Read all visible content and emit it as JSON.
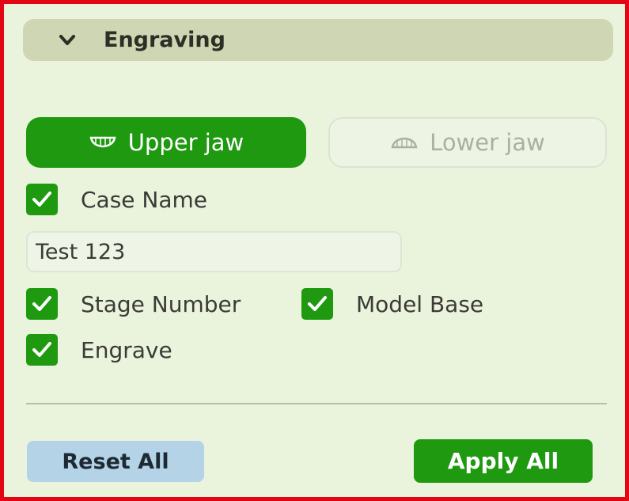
{
  "panel": {
    "title": "Engraving",
    "expanded": true
  },
  "jaw_selector": {
    "upper_label": "Upper jaw",
    "lower_label": "Lower jaw",
    "selected": "upper"
  },
  "case_name": {
    "label": "Case Name",
    "checked": true,
    "value": "Test 123"
  },
  "stage_number": {
    "label": "Stage Number",
    "checked": true
  },
  "model_base": {
    "label": "Model Base",
    "checked": true
  },
  "engrave": {
    "label": "Engrave",
    "checked": true
  },
  "footer": {
    "reset_label": "Reset All",
    "apply_label": "Apply All"
  },
  "colors": {
    "accent_green": "#1f9a10",
    "frame_red": "#e30613",
    "panel_bg": "#eaf3dc",
    "header_bg": "#cfd6b4",
    "reset_blue": "#b4d3e6"
  },
  "icons": {
    "panel_toggle": "chevron-down-icon",
    "upper_jaw": "upper-jaw-icon",
    "lower_jaw": "lower-jaw-icon",
    "check": "checkmark-icon"
  }
}
